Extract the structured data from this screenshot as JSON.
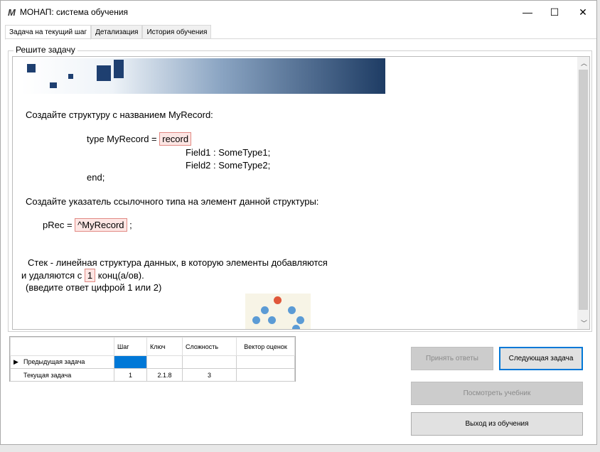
{
  "window": {
    "logo": "M",
    "title": "МОНАП: система обучения",
    "minimize": "—",
    "maximize": "☐",
    "close": "✕"
  },
  "tabs": [
    "Задача на текущий шаг",
    "Детализация",
    "История обучения"
  ],
  "group_label": "Решите задачу",
  "task": {
    "line1": "Создайте структуру с названием MyRecord:",
    "type_prefix": "type MyRecord = ",
    "answer1": "record",
    "field1": "Field1 : SomeType1;",
    "field2": "Field2 : SomeType2;",
    "end": "end;",
    "line2": "Создайте указатель ссылочного типа на элемент данной структуры:",
    "prec": "pRec = ",
    "answer2": "^MyRecord",
    "semicolon": " ;",
    "line3": "Стек - линейная структура данных, в которую элементы добавляются",
    "line4a": "и удаляются с ",
    "answer3": "1",
    "line4b": "  конц(а/ов).",
    "line5": "(введите ответ цифрой  1 или 2)"
  },
  "grid": {
    "headers": [
      "",
      "Шаг",
      "Ключ",
      "Сложность",
      "Вектор оценок"
    ],
    "rows": [
      {
        "marker": "▶",
        "label": "Предыдущая задача",
        "step": "",
        "key": "",
        "complexity": "",
        "vector": ""
      },
      {
        "marker": "",
        "label": "Текущая задача",
        "step": "1",
        "key": "2.1.8",
        "complexity": "3",
        "vector": ""
      }
    ]
  },
  "buttons": {
    "accept": "Принять ответы",
    "next": "Следующая задача",
    "textbook": "Посмотреть учебник",
    "exit": "Выход из обучения"
  },
  "colors": {
    "selected_cell": "#0078d7",
    "answer_bg": "#fde6e4"
  }
}
